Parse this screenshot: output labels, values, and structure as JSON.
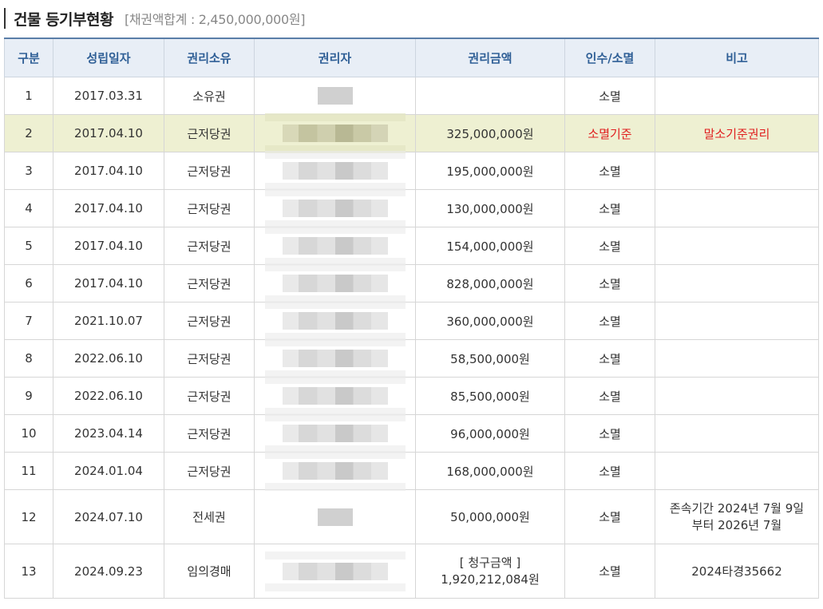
{
  "section": {
    "title": "건물 등기부현황",
    "subtitle": "[채권액합계 : 2,450,000,000원]"
  },
  "table": {
    "headers": [
      "구분",
      "성립일자",
      "권리소유",
      "권리자",
      "권리금액",
      "인수/소멸",
      "비고"
    ],
    "rows": [
      {
        "no": "1",
        "date": "2017.03.31",
        "type": "소유권",
        "amount": "",
        "status": "소멸",
        "remark": ""
      },
      {
        "no": "2",
        "date": "2017.04.10",
        "type": "근저당권",
        "amount": "325,000,000원",
        "status": "소멸기준",
        "remark": "말소기준권리"
      },
      {
        "no": "3",
        "date": "2017.04.10",
        "type": "근저당권",
        "amount": "195,000,000원",
        "status": "소멸",
        "remark": ""
      },
      {
        "no": "4",
        "date": "2017.04.10",
        "type": "근저당권",
        "amount": "130,000,000원",
        "status": "소멸",
        "remark": ""
      },
      {
        "no": "5",
        "date": "2017.04.10",
        "type": "근저당권",
        "amount": "154,000,000원",
        "status": "소멸",
        "remark": ""
      },
      {
        "no": "6",
        "date": "2017.04.10",
        "type": "근저당권",
        "amount": "828,000,000원",
        "status": "소멸",
        "remark": ""
      },
      {
        "no": "7",
        "date": "2021.10.07",
        "type": "근저당권",
        "amount": "360,000,000원",
        "status": "소멸",
        "remark": ""
      },
      {
        "no": "8",
        "date": "2022.06.10",
        "type": "근저당권",
        "amount": "58,500,000원",
        "status": "소멸",
        "remark": ""
      },
      {
        "no": "9",
        "date": "2022.06.10",
        "type": "근저당권",
        "amount": "85,500,000원",
        "status": "소멸",
        "remark": ""
      },
      {
        "no": "10",
        "date": "2023.04.14",
        "type": "근저당권",
        "amount": "96,000,000원",
        "status": "소멸",
        "remark": ""
      },
      {
        "no": "11",
        "date": "2024.01.04",
        "type": "근저당권",
        "amount": "168,000,000원",
        "status": "소멸",
        "remark": ""
      },
      {
        "no": "12",
        "date": "2024.07.10",
        "type": "전세권",
        "amount": "50,000,000원",
        "status": "소멸",
        "remark_line1": "존속기간 2024년 7월 9일",
        "remark_line2": "부터 2026년 7월"
      },
      {
        "no": "13",
        "date": "2024.09.23",
        "type": "임의경매",
        "amount_line1": "[ 청구금액 ]",
        "amount_line2": "1,920,212,084원",
        "status": "소멸",
        "remark": "2024타경35662"
      }
    ]
  },
  "colors": {
    "header_text": "#2f5f96",
    "header_bg": "#e8eef6",
    "highlight_row_bg": "#eef0d2",
    "alert_red": "#e02020"
  }
}
